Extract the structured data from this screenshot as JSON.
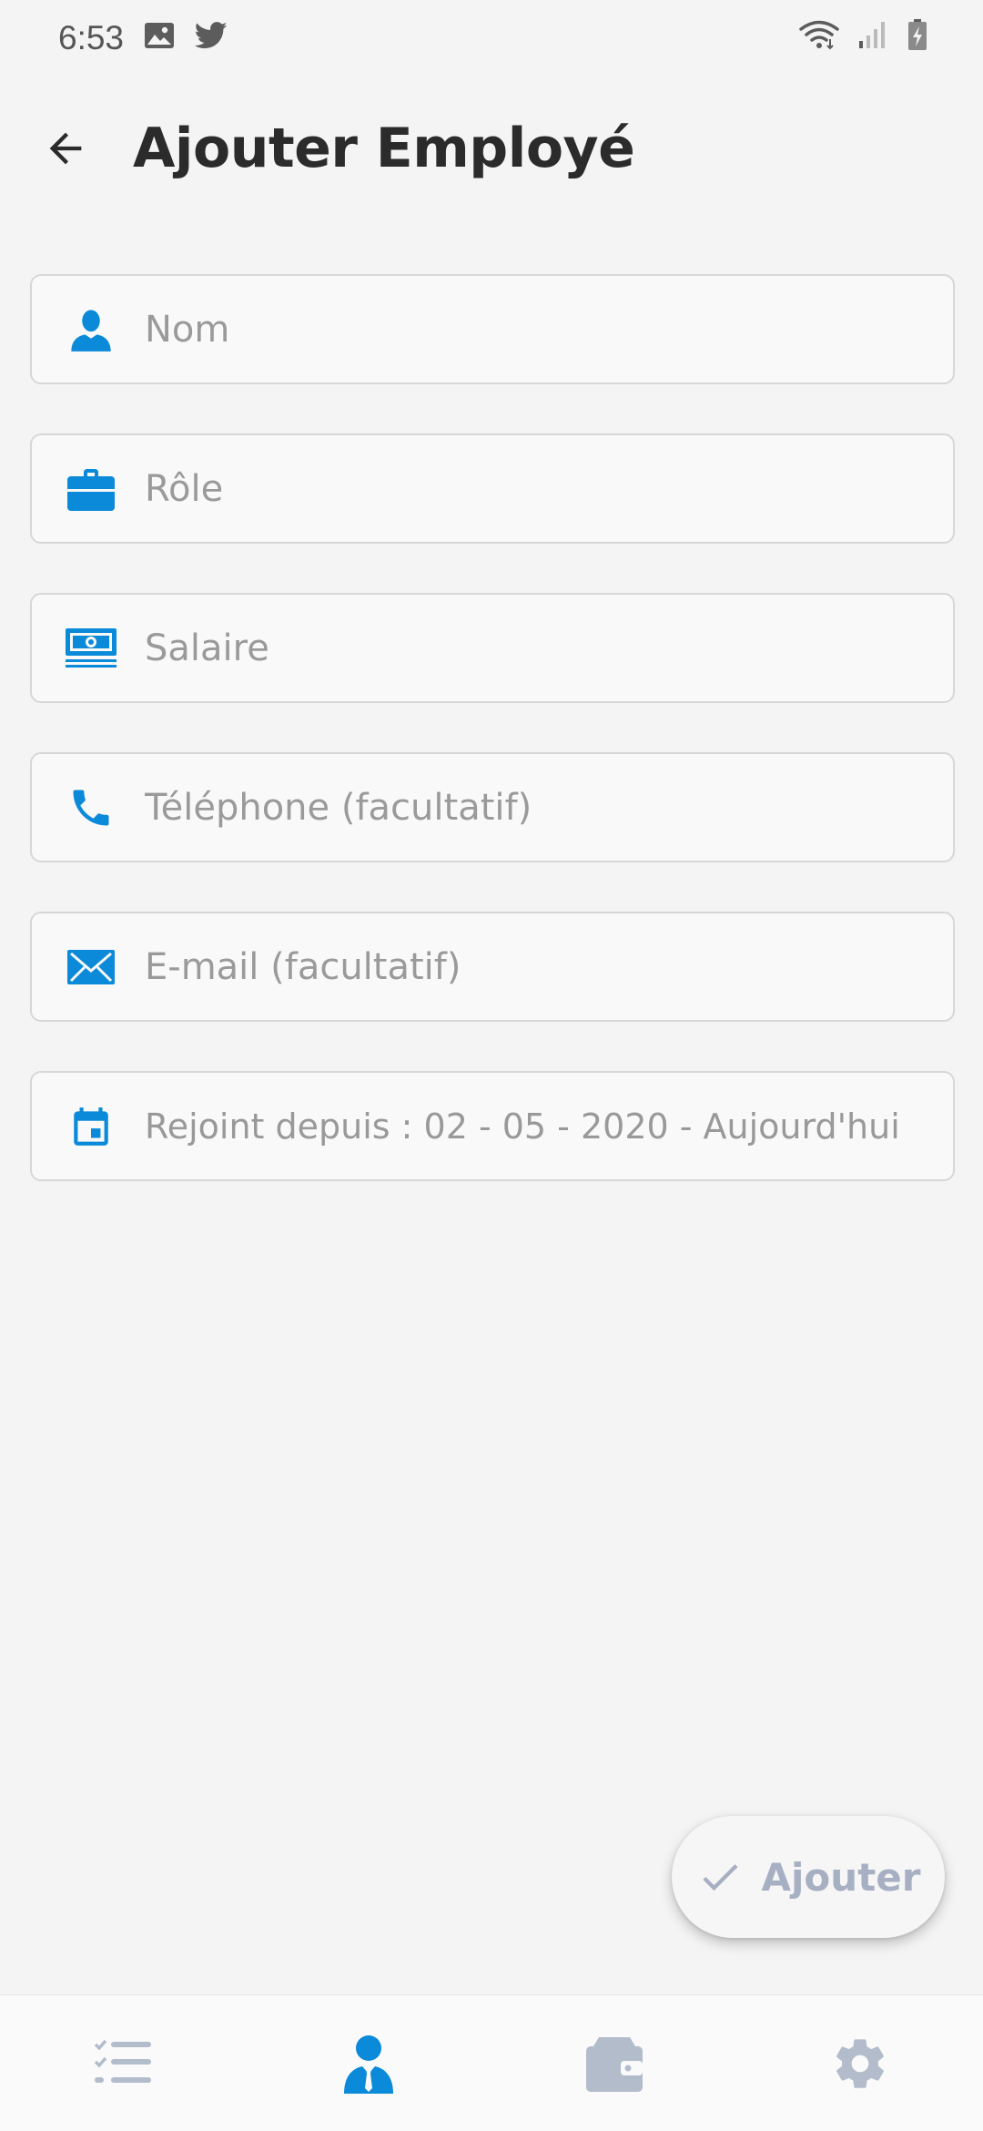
{
  "status_bar": {
    "time": "6:53"
  },
  "app_bar": {
    "title": "Ajouter Employé"
  },
  "form": {
    "name_placeholder": "Nom",
    "role_placeholder": "Rôle",
    "salary_placeholder": "Salaire",
    "phone_placeholder": "Téléphone (facultatif)",
    "email_placeholder": "E-mail (facultatif)",
    "join_date_text": "Rejoint depuis :  02 - 05 - 2020 - Aujourd'hui"
  },
  "fab": {
    "label": "Ajouter"
  },
  "bottom_nav": {
    "items": [
      {
        "icon": "checklist-icon",
        "active": false
      },
      {
        "icon": "employee-icon",
        "active": true
      },
      {
        "icon": "wallet-icon",
        "active": false
      },
      {
        "icon": "gear-icon",
        "active": false
      }
    ]
  },
  "colors": {
    "accent": "#0a8ad8",
    "inactive_nav": "#b3bccb",
    "fab_text": "#a7afc2",
    "background": "#f4f4f4"
  }
}
